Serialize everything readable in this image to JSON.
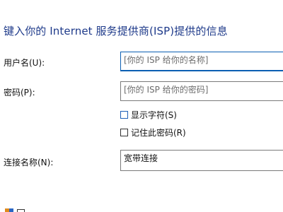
{
  "header": {
    "title": "键入你的 Internet 服务提供商(ISP)提供的信息"
  },
  "form": {
    "username_label": "用户名(U):",
    "username_placeholder": "[你的 ISP 给你的名称]",
    "password_label": "密码(P):",
    "password_placeholder": "[你的 ISP 给你的密码]",
    "show_chars_label": "显示字符(S)",
    "remember_label": "记住此密码(R)",
    "connection_label": "连接名称(N):",
    "connection_value": "宽带连接"
  },
  "icons": {
    "shield": "shield-icon"
  }
}
